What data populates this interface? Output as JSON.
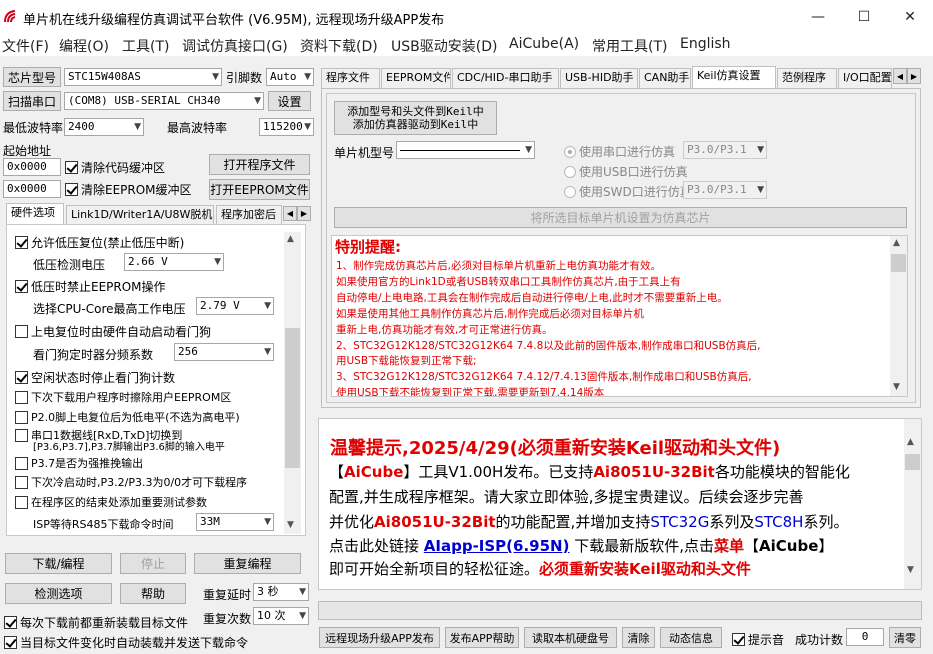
{
  "window": {
    "title": "单片机在线升级编程仿真调试平台软件 (V6.95M), 远程现场升级APP发布",
    "minimize": "—",
    "maximize": "☐",
    "close": "✕"
  },
  "menu": [
    "文件(F)",
    "编程(O)",
    "工具(T)",
    "调试仿真接口(G)",
    "资料下载(D)",
    "USB驱动安装(D)",
    "AiCube(A)",
    "常用工具(T)",
    "English"
  ],
  "left": {
    "chip_label": "芯片型号",
    "chip_value": "STC15W408AS",
    "pins_label": "引脚数",
    "pins_value": "Auto",
    "scan_label": "扫描串口",
    "port_value": "(COM8) USB-SERIAL CH340",
    "settings_label": "设置",
    "min_baud_label": "最低波特率",
    "min_baud_value": "2400",
    "max_baud_label": "最高波特率",
    "max_baud_value": "115200",
    "start_addr_label": "起始地址",
    "addr1": "0x0000",
    "clear_code_label": "清除代码缓冲区",
    "open_prog_label": "打开程序文件",
    "addr2": "0x0000",
    "clear_eeprom_label": "清除EEPROM缓冲区",
    "open_eeprom_label": "打开EEPROM文件",
    "tabs": [
      "硬件选项",
      "Link1D/Writer1A/U8W脱机",
      "程序加密后"
    ],
    "options": [
      {
        "label": "允许低压复位(禁止低压中断)",
        "checked": true
      },
      {
        "label": "低压检测电压",
        "value": "2.66 V"
      },
      {
        "label": "低压时禁止EEPROM操作",
        "checked": true
      },
      {
        "label": "选择CPU-Core最高工作电压",
        "value": "2.79 V"
      },
      {
        "label": "上电复位时由硬件自动启动看门狗",
        "checked": false
      },
      {
        "label": "看门狗定时器分频系数",
        "value": "256"
      },
      {
        "label": "空闲状态时停止看门狗计数",
        "checked": true
      },
      {
        "label": "下次下载用户程序时擦除用户EEPROM区",
        "checked": false
      },
      {
        "label": "P2.0脚上电复位后为低电平(不选为高电平)",
        "checked": false
      },
      {
        "label": "串口1数据线[RxD,TxD]切换到",
        "label2": "[P3.6,P3.7],P3.7脚输出P3.6脚的输入电平",
        "checked": false
      },
      {
        "label": "P3.7是否为强推挽输出",
        "checked": false
      },
      {
        "label": "下次冷启动时,P3.2/P3.3为0/0才可下载程序",
        "checked": false
      },
      {
        "label": "在程序区的结束处添加重要测试参数",
        "checked": false
      },
      {
        "label": "ISP等待RS485下载命令时间",
        "value": "33M"
      }
    ],
    "download_label": "下载/编程",
    "stop_label": "停止",
    "reprogram_label": "重复编程",
    "detect_label": "检测选项",
    "help_label": "帮助",
    "repeat_delay_label": "重复延时",
    "repeat_delay_value": "3 秒",
    "reload_label": "每次下载前都重新装载目标文件",
    "reload_checked": true,
    "repeat_count_label": "重复次数",
    "repeat_count_value": "10 次",
    "auto_label": "当目标文件变化时自动装载并发送下载命令",
    "auto_checked": true
  },
  "right": {
    "tabs": [
      "程序文件",
      "EEPROM文件",
      "CDC/HID-串口助手",
      "USB-HID助手",
      "CAN助手",
      "Keil仿真设置",
      "范例程序",
      "I/O口配置"
    ],
    "active_tab": 5,
    "add_keil_line1": "添加型号和头文件到Keil中",
    "add_keil_line2": "添加仿真器驱动到Keil中",
    "mcu_label": "单片机型号",
    "mcu_value": "",
    "radios": [
      {
        "label": "使用串口进行仿真",
        "value": "P3.0/P3.1",
        "on": true
      },
      {
        "label": "使用USB口进行仿真",
        "value": "",
        "on": false
      },
      {
        "label": "使用SWD口进行仿真",
        "value": "P3.0/P3.1",
        "on": false
      }
    ],
    "set_chip_label": "将所选目标单片机设置为仿真芯片",
    "notice_title": "特别提醒:",
    "notice_lines": [
      "1、制作完成仿真芯片后,必须对目标单片机重新上电仿真功能才有效。",
      "    如果使用官方的Link1D或者USB转双串口工具制作仿真芯片,由于工具上有",
      "    自动停电/上电电路,工具会在制作完成后自动进行停电/上电,此时才不需要重新上电。",
      "    如果是使用其他工具制作仿真芯片后,制作完成后必须对目标单片机",
      "    重新上电,仿真功能才有效,才可正常进行仿真。",
      "2、STC32G12K128/STC32G12K64  7.4.8以及此前的固件版本,制作成串口和USB仿真后,",
      "    用USB下载能恢复到正常下载;",
      "3、STC32G12K128/STC32G12K64  7.4.12/7.4.13固件版本,制作成串口和USB仿真后,",
      "    使用USB下载不能恢复到正常下载,需要更新到7.4.14版本"
    ],
    "tip_title": "温馨提示,2025/4/29(必须重新安装Keil驱动和头文件)",
    "tip": {
      "l1a": "【",
      "l1b": "AiCube",
      "l1c": "】工具V1.00H发布。已支持",
      "l1d": "Ai8051U-32Bit",
      "l1e": "各功能模块的智能化",
      "l2": "配置,并生成程序框架。请大家立即体验,多提宝贵建议。后续会逐步完善",
      "l3a": "并优化",
      "l3b": "Ai8051U-32Bit",
      "l3c": "的功能配置,并增加支持",
      "l3d": "STC32G",
      "l3e": "系列及",
      "l3f": "STC8H",
      "l3g": "系列。",
      "l4a": "点击此处链接 ",
      "l4b": "AIapp-ISP(6.95N)",
      "l4c": " 下载最新版软件,点击",
      "l4d": "菜单",
      "l4e": "【",
      "l4f": "AiCube",
      "l4g": "】",
      "l5a": "即可开始全新项目的轻松征途。",
      "l5b": "必须重新安装Keil驱动和头文件"
    },
    "bottom": {
      "remote_label": "远程现场升级APP发布",
      "publish_help_label": "发布APP帮助",
      "disk_label": "读取本机硬盘号",
      "clear_label": "清除",
      "dynamic_label": "动态信息",
      "beep_label": "提示音",
      "beep_checked": true,
      "success_label": "成功计数",
      "success_value": "0",
      "clear2_label": "清零"
    }
  }
}
